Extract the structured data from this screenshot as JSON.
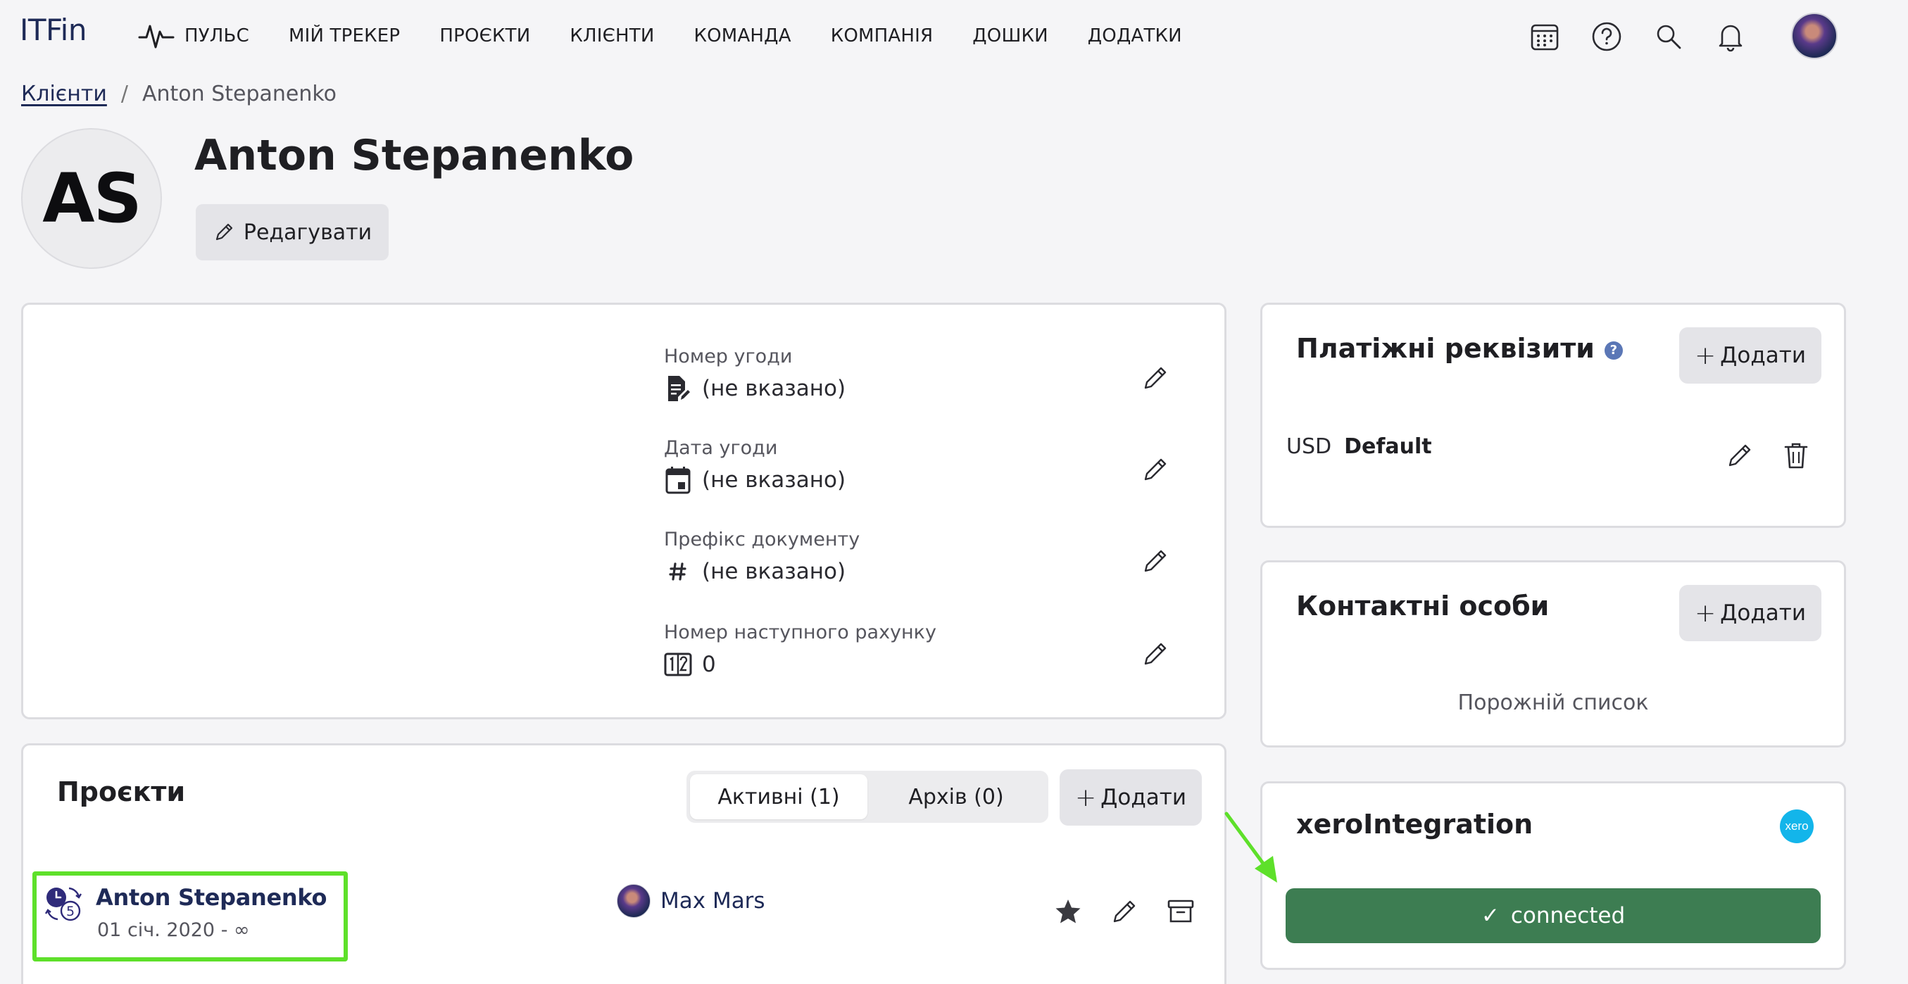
{
  "app": {
    "logo": "ITFin"
  },
  "nav": {
    "items": [
      {
        "label": "ПУЛЬС",
        "icon": "pulse-icon"
      },
      {
        "label": "МІЙ ТРЕКЕР"
      },
      {
        "label": "ПРОЄКТИ"
      },
      {
        "label": "КЛІЄНТИ"
      },
      {
        "label": "КОМАНДА"
      },
      {
        "label": "КОМПАНІЯ"
      },
      {
        "label": "ДОШКИ"
      },
      {
        "label": "ДОДАТКИ"
      }
    ],
    "icons": [
      "calendar-icon",
      "help-icon",
      "search-icon",
      "bell-icon"
    ]
  },
  "breadcrumb": {
    "parent": "Клієнти",
    "separator": "/",
    "current": "Anton Stepanenko"
  },
  "client": {
    "initials": "AS",
    "name": "Anton Stepanenko",
    "edit_label": "Редагувати"
  },
  "details": {
    "fields": [
      {
        "label": "Номер угоди",
        "value": "(не вказано)",
        "icon": "document-edit-icon"
      },
      {
        "label": "Дата угоди",
        "value": "(не вказано)",
        "icon": "calendar-day-icon"
      },
      {
        "label": "Префікс документу",
        "value": "(не вказано)",
        "icon": "hash-icon"
      },
      {
        "label": "Номер наступного рахунку",
        "value": "0",
        "icon": "number-counter-icon"
      }
    ]
  },
  "payment": {
    "title": "Платіжні реквізити",
    "help": "?",
    "add_label": "Додати",
    "plus": "+",
    "rows": [
      {
        "currency": "USD",
        "name": "Default"
      }
    ]
  },
  "contacts": {
    "title": "Контактні особи",
    "add_label": "Додати",
    "plus": "+",
    "empty": "Порожній список"
  },
  "xero": {
    "title": "xeroIntegration",
    "logo_text": "xero",
    "status_label": "connected",
    "check": "✓"
  },
  "projects": {
    "title": "Проєкти",
    "tabs": [
      {
        "label": "Активні (1)",
        "active": true
      },
      {
        "label": "Архів (0)",
        "active": false
      }
    ],
    "add_label": "Додати",
    "plus": "+",
    "items": [
      {
        "name": "Anton Stepanenko",
        "dates": "01 січ. 2020 - ∞",
        "manager": "Max Mars",
        "badge": "5"
      }
    ]
  },
  "colors": {
    "accent": "#1e2a57",
    "connected": "#3d7d52",
    "highlight": "#5ee02a",
    "xero": "#13b5ea"
  }
}
